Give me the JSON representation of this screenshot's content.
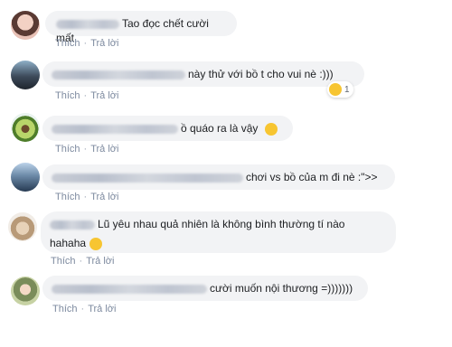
{
  "comments": [
    {
      "text": "Tao đọc chết cười mất",
      "like": "Thích",
      "reply": "Trả lời"
    },
    {
      "text": "này thử với bồ t cho vui nè :)))",
      "like": "Thích",
      "reply": "Trả lời",
      "reaction_count": "1"
    },
    {
      "text": "ồ quáo ra là vậy",
      "like": "Thích",
      "reply": "Trả lời"
    },
    {
      "text": "chơi vs bồ của m đi nè :\">>",
      "like": "Thích",
      "reply": "Trả lời"
    },
    {
      "text": "Lũ yêu nhau quả nhiên là không bình thường tí nào",
      "text2": "hahaha",
      "like": "Thích",
      "reply": "Trả lời"
    },
    {
      "text": "cười muốn nội thương =)))))))",
      "like": "Thích",
      "reply": "Trả lời"
    }
  ],
  "colors": {
    "bubble": "#f2f3f5",
    "action": "#7d8a9f",
    "emoji": "#f7c531"
  }
}
